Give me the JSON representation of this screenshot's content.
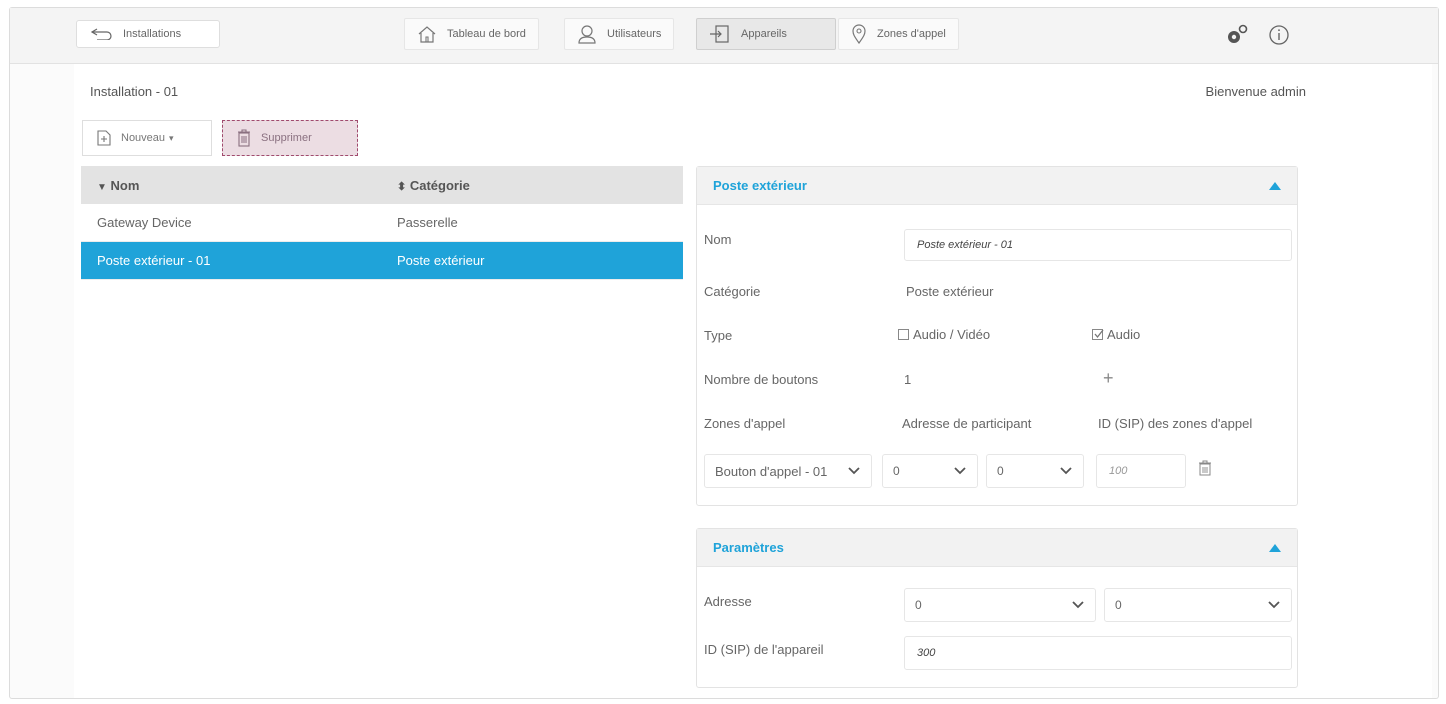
{
  "topbar": {
    "back_label": "Installations",
    "tabs": [
      {
        "label": "Tableau de bord",
        "icon": "home-icon"
      },
      {
        "label": "Utilisateurs",
        "icon": "user-icon"
      },
      {
        "label": "Appareils",
        "icon": "device-icon"
      },
      {
        "label": "Zones d'appel",
        "icon": "location-pin-icon"
      }
    ],
    "active_tab": "Appareils"
  },
  "header": {
    "installation_title": "Installation - 01",
    "welcome": "Bienvenue admin"
  },
  "toolbar": {
    "new_label": "Nouveau",
    "delete_label": "Supprimer"
  },
  "table": {
    "columns": [
      "Nom",
      "Catégorie"
    ],
    "rows": [
      {
        "name": "Gateway Device",
        "category": "Passerelle"
      },
      {
        "name": "Poste extérieur - 01",
        "category": "Poste extérieur"
      }
    ],
    "selected_index": 1
  },
  "panel_outdoor": {
    "title": "Poste extérieur",
    "name_label": "Nom",
    "name_value": "Poste extérieur - 01",
    "category_label": "Catégorie",
    "category_value": "Poste extérieur",
    "type_label": "Type",
    "type_audio_video": "Audio / Vidéo",
    "type_audio": "Audio",
    "buttons_label": "Nombre de boutons",
    "buttons_value": "1",
    "add_symbol": "+",
    "zones_label": "Zones d'appel",
    "participant_header": "Adresse de participant",
    "sip_zone_header": "ID (SIP) des zones d'appel",
    "call_button": "Bouton d'appel - 01",
    "addr_a": "0",
    "addr_b": "0",
    "sip_zone_value": "100"
  },
  "panel_params": {
    "title": "Paramètres",
    "address_label": "Adresse",
    "address_a": "0",
    "address_b": "0",
    "sip_label": "ID (SIP) de l'appareil",
    "sip_value": "300"
  },
  "colors": {
    "accent": "#1fa3d9",
    "delete_bg": "#ecdde3",
    "delete_border": "#a04a6d"
  }
}
